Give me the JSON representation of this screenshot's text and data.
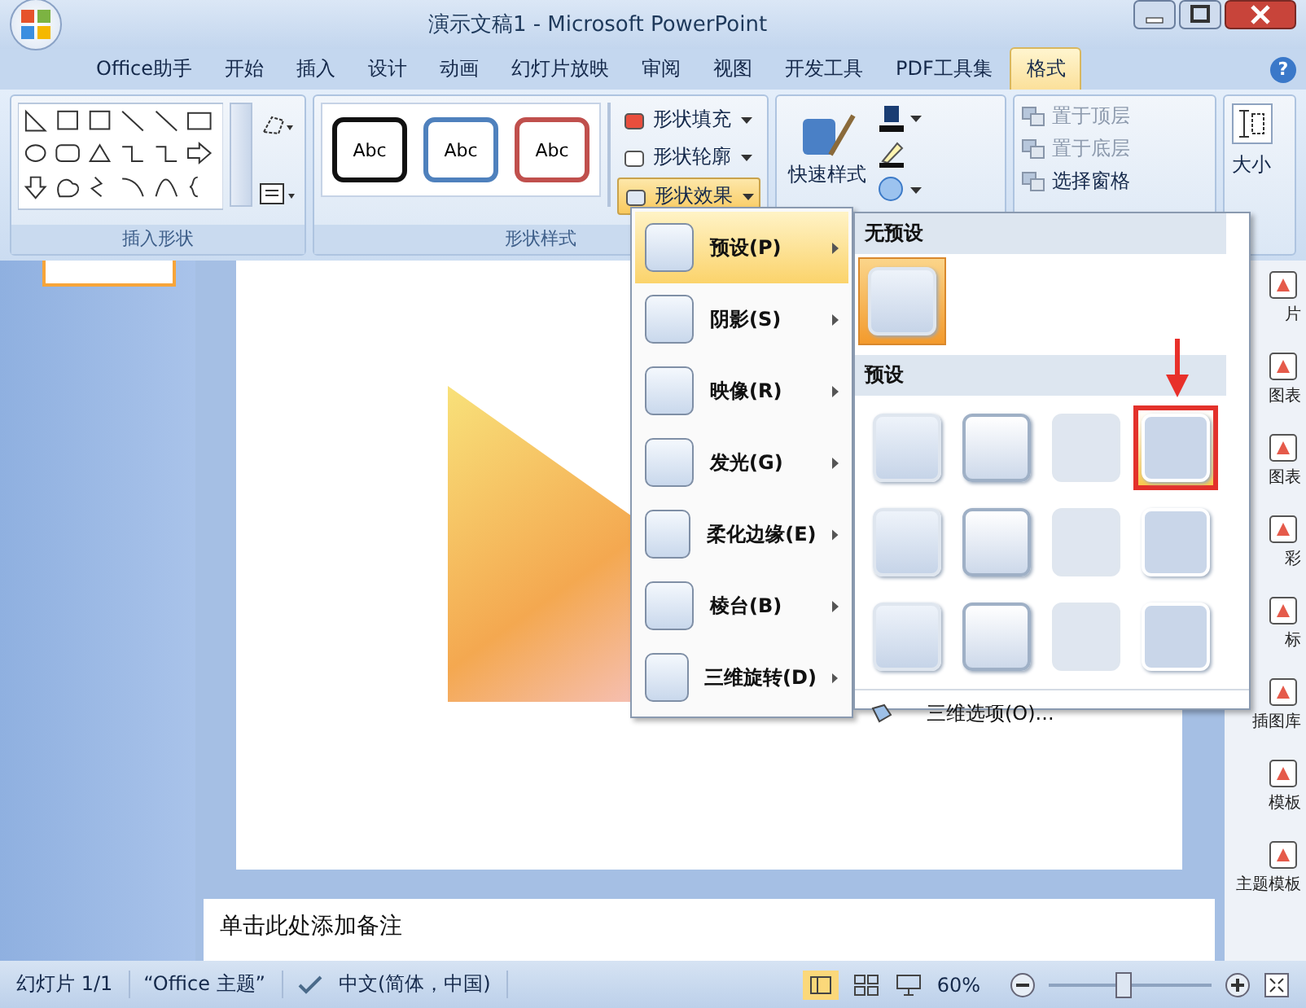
{
  "window": {
    "title": "演示文稿1 - Microsoft PowerPoint"
  },
  "tabs": [
    {
      "label": "Office助手",
      "selected": false
    },
    {
      "label": "开始",
      "selected": false
    },
    {
      "label": "插入",
      "selected": false
    },
    {
      "label": "设计",
      "selected": false
    },
    {
      "label": "动画",
      "selected": false
    },
    {
      "label": "幻灯片放映",
      "selected": false
    },
    {
      "label": "审阅",
      "selected": false
    },
    {
      "label": "视图",
      "selected": false
    },
    {
      "label": "开发工具",
      "selected": false
    },
    {
      "label": "PDF工具集",
      "selected": false
    },
    {
      "label": "格式",
      "selected": true
    }
  ],
  "help": "?",
  "ribbon": {
    "insert_shapes": {
      "label": "插入形状"
    },
    "shape_styles": {
      "label": "形状样式",
      "samples": [
        {
          "text": "Abc",
          "color": "#111111"
        },
        {
          "text": "Abc",
          "color": "#4f81bd"
        },
        {
          "text": "Abc",
          "color": "#c0504d"
        }
      ],
      "buttons": [
        {
          "label": "形状填充",
          "selected": false
        },
        {
          "label": "形状轮廓",
          "selected": false
        },
        {
          "label": "形状效果",
          "selected": true
        }
      ]
    },
    "wordart": {
      "quick_styles": "快速样式"
    },
    "arrange": {
      "items": [
        {
          "label": "置于顶层",
          "disabled": true
        },
        {
          "label": "置于底层",
          "disabled": true
        },
        {
          "label": "选择窗格",
          "disabled": false
        }
      ]
    },
    "size": {
      "label": "大小"
    }
  },
  "effects_menu": {
    "items": [
      {
        "label": "预设(P)",
        "selected": true
      },
      {
        "label": "阴影(S)",
        "selected": false
      },
      {
        "label": "映像(R)",
        "selected": false
      },
      {
        "label": "发光(G)",
        "selected": false
      },
      {
        "label": "柔化边缘(E)",
        "selected": false
      },
      {
        "label": "棱台(B)",
        "selected": false
      },
      {
        "label": "三维旋转(D)",
        "selected": false
      }
    ]
  },
  "preset_gallery": {
    "no_preset_heading": "无预设",
    "preset_heading": "预设",
    "presets": [
      {
        "selected": false
      },
      {
        "selected": false
      },
      {
        "selected": false
      },
      {
        "selected": true
      },
      {
        "selected": false
      },
      {
        "selected": false
      },
      {
        "selected": false
      },
      {
        "selected": false
      },
      {
        "selected": false
      },
      {
        "selected": false
      },
      {
        "selected": false
      },
      {
        "selected": false
      }
    ],
    "options": "三维选项(O)..."
  },
  "task_pane": {
    "items": [
      "片",
      "图表",
      "图表",
      "彩",
      "标",
      "插图库",
      "模板",
      "主题模板"
    ]
  },
  "notes": {
    "placeholder": "单击此处添加备注"
  },
  "status_bar": {
    "slide": "幻灯片 1/1",
    "theme": "“Office 主题”",
    "language": "中文(简体，中国)",
    "zoom": "60%",
    "zoom_slider": {
      "level": 0.45
    }
  }
}
